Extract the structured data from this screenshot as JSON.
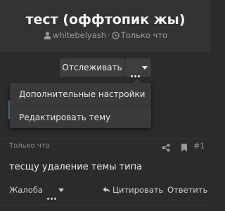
{
  "topic": {
    "title": "тест (оффтопик жы)",
    "author": "whitebelyash",
    "time": "Только что"
  },
  "toolbar": {
    "follow_label": "Отслеживать",
    "more_icon": "ellipsis-icon"
  },
  "menu": {
    "items": [
      {
        "label": "Дополнительные настройки"
      },
      {
        "label": "Редактировать тему"
      }
    ]
  },
  "post": {
    "time": "Только что",
    "number": "#1",
    "body": "тесщу удаление темы типа",
    "actions": {
      "report": "Жалоба",
      "quote": "Цитировать",
      "reply": "Ответить"
    }
  }
}
